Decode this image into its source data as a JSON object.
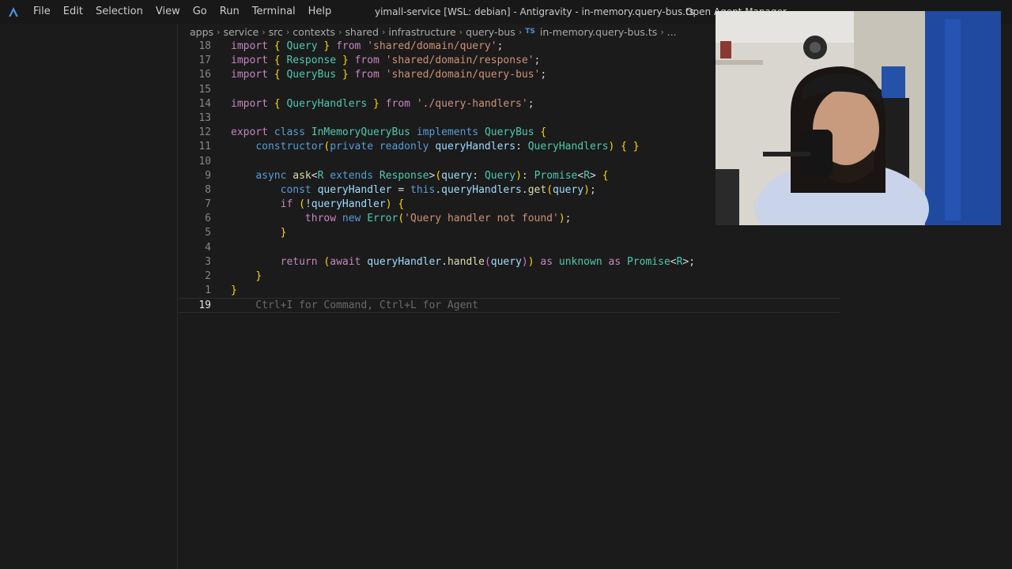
{
  "menu": {
    "items": [
      "File",
      "Edit",
      "Selection",
      "View",
      "Go",
      "Run",
      "Terminal",
      "Help"
    ]
  },
  "window_title": "yimall-service [WSL: debian] - Antigravity - in-memory.query-bus.ts",
  "agent_manager_label": "Open Agent Manager",
  "breadcrumb": {
    "segments": [
      "apps",
      "service",
      "src",
      "contexts",
      "shared",
      "infrastructure",
      "query-bus"
    ],
    "file_badge": "TS",
    "file": "in-memory.query-bus.ts",
    "more": "..."
  },
  "editor": {
    "line_numbers": [
      "18",
      "17",
      "16",
      "15",
      "14",
      "13",
      "12",
      "11",
      "10",
      "9",
      "8",
      "7",
      "6",
      "5",
      "4",
      "3",
      "2",
      "1",
      "19"
    ],
    "lines": [
      "import { Query } from 'shared/domain/query';",
      "import { Response } from 'shared/domain/response';",
      "import { QueryBus } from 'shared/domain/query-bus';",
      "",
      "import { QueryHandlers } from './query-handlers';",
      "",
      "export class InMemoryQueryBus implements QueryBus {",
      "    constructor(private readonly queryHandlers: QueryHandlers) { }",
      "",
      "    async ask<R extends Response>(query: Query): Promise<R> {",
      "        const queryHandler = this.queryHandlers.get(query);",
      "        if (!queryHandler) {",
      "            throw new Error('Query handler not found');",
      "        }",
      "",
      "        return (await queryHandler.handle(query)) as unknown as Promise<R>;",
      "    }",
      "}",
      "    Ctrl+I for Command, Ctrl+L for Agent"
    ]
  },
  "colors": {
    "background": "#1b1b1b",
    "keyword": "#569cd6",
    "type": "#4ec9b0",
    "function": "#dcdcaa",
    "string": "#ce9178",
    "variable": "#9cdcfe",
    "bracket_gold": "#ffd700",
    "bracket_pink": "#da70d6"
  },
  "icons": {
    "app_logo": "antigravity-logo-icon",
    "file_type": "typescript-icon"
  }
}
